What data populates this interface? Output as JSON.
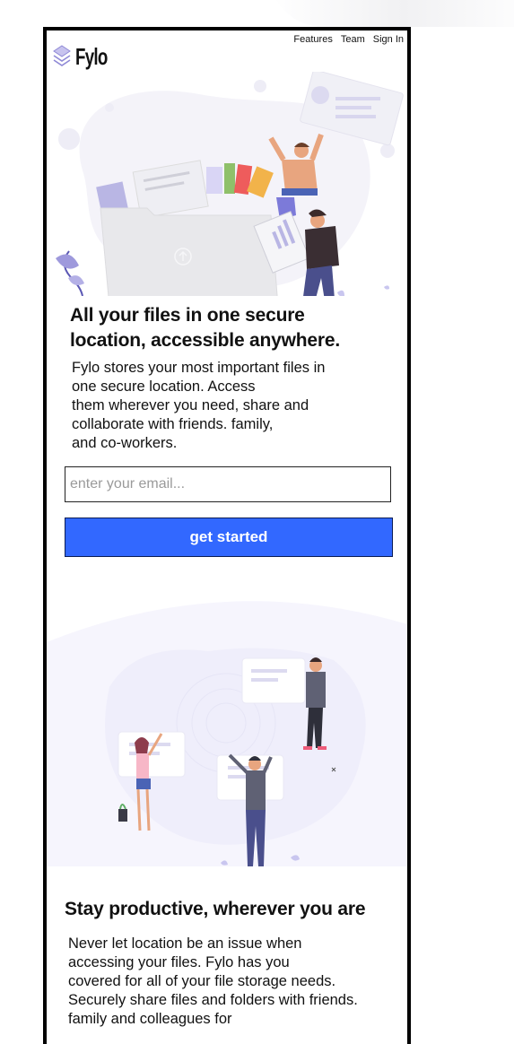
{
  "brand": {
    "name": "Fylo",
    "accent": "#3268ff"
  },
  "nav": {
    "features": "Features",
    "team": "Team",
    "signin": "Sign In"
  },
  "hero": {
    "title_line1": "All your files in one secure",
    "title_line2": "location, accessible anywhere.",
    "desc_lines": [
      "Fylo stores your most important files in",
      "one secure location. Access",
      "them wherever you need, share and",
      "collaborate with friends. family,",
      "and co-workers."
    ]
  },
  "signup": {
    "email_placeholder": "enter your email...",
    "button_label": "get started"
  },
  "productive": {
    "title": "Stay productive, wherever you are",
    "desc_lines": [
      "Never let location be an issue when",
      "accessing your files. Fylo has you",
      "covered for all of your file storage needs.",
      "Securely share files and folders with friends.",
      "family and colleagues for"
    ]
  },
  "icons": {
    "logo": "stacked-layers-icon",
    "upload": "upload-arrow-icon"
  }
}
